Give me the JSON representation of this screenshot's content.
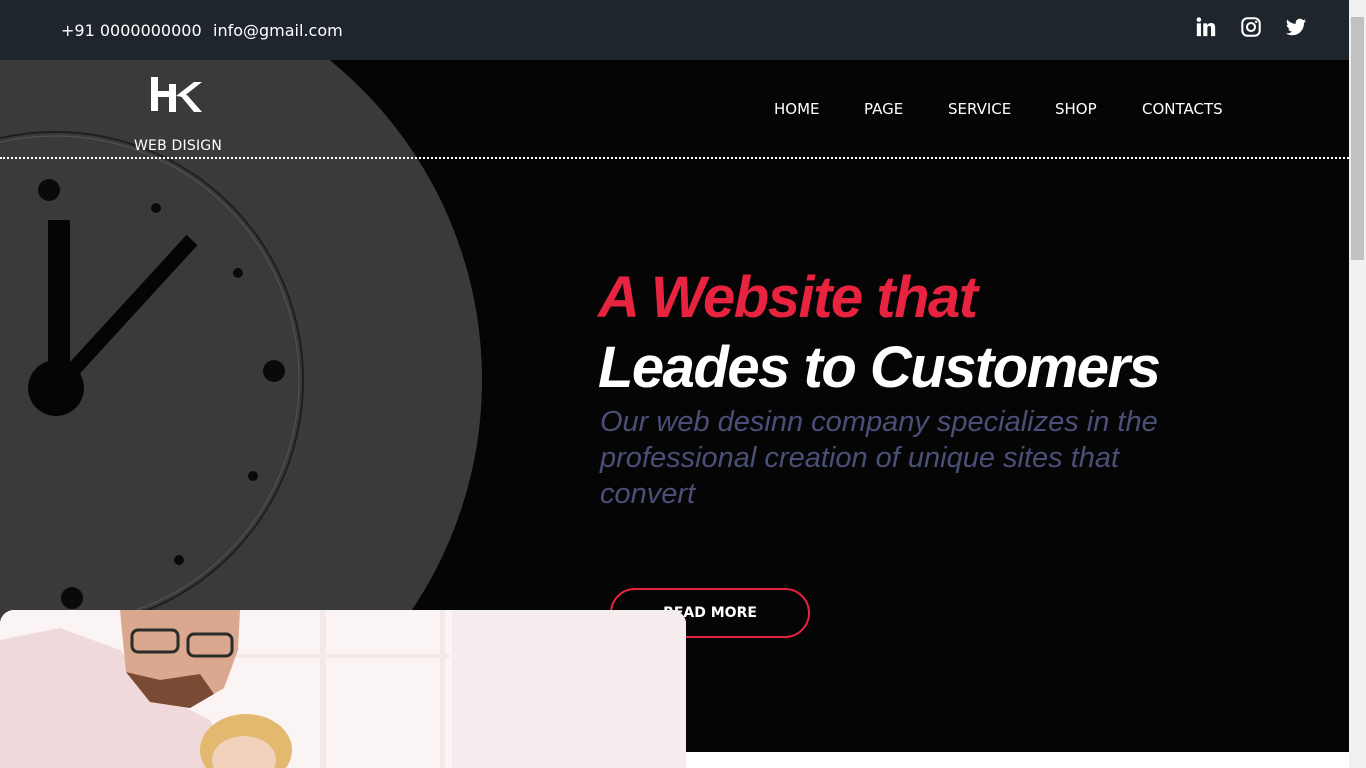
{
  "topbar": {
    "phone": "+91 0000000000",
    "email": "info@gmail.com",
    "social": [
      {
        "name": "linkedin",
        "icon": "linkedin-icon"
      },
      {
        "name": "instagram",
        "icon": "instagram-icon"
      },
      {
        "name": "twitter",
        "icon": "twitter-icon"
      }
    ]
  },
  "header": {
    "logo_text": "WEB DISIGN",
    "nav": [
      "HOME",
      "PAGE",
      "SERVICE",
      "SHOP",
      "CONTACTS"
    ]
  },
  "hero": {
    "headline_line1": "A Website that",
    "headline_line2": "Leades to Customers",
    "subtitle": "Our web desinn company specializes in the professional creation of unique sites that convert",
    "cta_label": "READ MORE"
  },
  "colors": {
    "topbar_bg": "#1f252c",
    "hero_bg": "#050505",
    "accent": "#e8233f",
    "subtitle": "#4b4f78"
  }
}
